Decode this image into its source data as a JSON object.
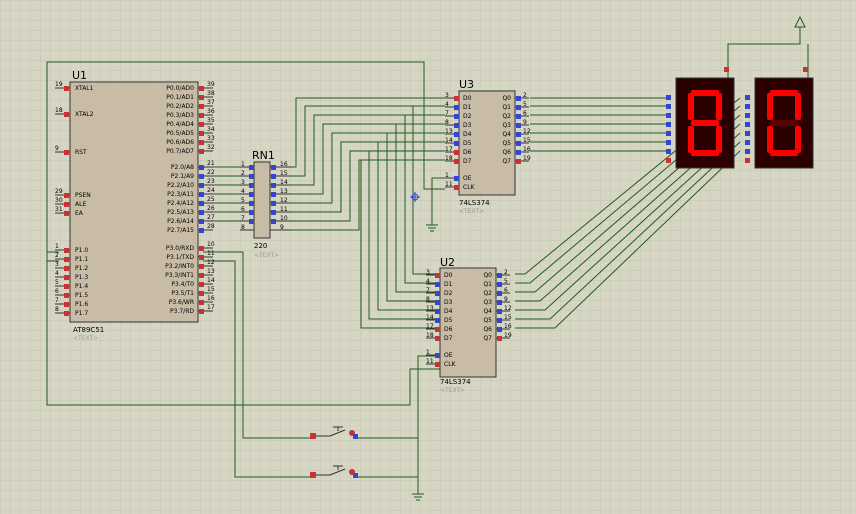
{
  "colors": {
    "background": "#d6d6c4",
    "grid": "#c4c4b0",
    "chip_fill": "#c8bca7",
    "outline": "#333333",
    "wire": "#1f5a1f",
    "pin_red": "#c83232",
    "pin_blue": "#3246d0",
    "segment_on": "#ff0000",
    "segment_off": "#5a0000",
    "display_bg": "#2a0000",
    "text_dim": "#9a9a88"
  },
  "u1": {
    "ref": "U1",
    "part": "AT89C51",
    "text_placeholder": "<TEXT>",
    "left_pins": [
      {
        "num": "19",
        "name": "XTAL1"
      },
      {
        "num": "18",
        "name": "XTAL2"
      },
      {
        "num": "9",
        "name": "RST"
      },
      {
        "num": "29",
        "name": "PSEN"
      },
      {
        "num": "30",
        "name": "ALE"
      },
      {
        "num": "31",
        "name": "EA"
      },
      {
        "num": "1",
        "name": "P1.0"
      },
      {
        "num": "2",
        "name": "P1.1"
      },
      {
        "num": "3",
        "name": "P1.2"
      },
      {
        "num": "4",
        "name": "P1.3"
      },
      {
        "num": "5",
        "name": "P1.4"
      },
      {
        "num": "6",
        "name": "P1.5"
      },
      {
        "num": "7",
        "name": "P1.6"
      },
      {
        "num": "8",
        "name": "P1.7"
      }
    ],
    "right_pins": [
      {
        "num": "39",
        "name": "P0.0/AD0"
      },
      {
        "num": "38",
        "name": "P0.1/AD1"
      },
      {
        "num": "37",
        "name": "P0.2/AD2"
      },
      {
        "num": "36",
        "name": "P0.3/AD3"
      },
      {
        "num": "35",
        "name": "P0.4/AD4"
      },
      {
        "num": "34",
        "name": "P0.5/AD5"
      },
      {
        "num": "33",
        "name": "P0.6/AD6"
      },
      {
        "num": "32",
        "name": "P0.7/AD7"
      },
      {
        "num": "21",
        "name": "P2.0/A8"
      },
      {
        "num": "22",
        "name": "P2.1/A9"
      },
      {
        "num": "23",
        "name": "P2.2/A10"
      },
      {
        "num": "24",
        "name": "P2.3/A11"
      },
      {
        "num": "25",
        "name": "P2.4/A12"
      },
      {
        "num": "26",
        "name": "P2.5/A13"
      },
      {
        "num": "27",
        "name": "P2.6/A14"
      },
      {
        "num": "28",
        "name": "P2.7/A15"
      },
      {
        "num": "10",
        "name": "P3.0/RXD"
      },
      {
        "num": "11",
        "name": "P3.1/TXD"
      },
      {
        "num": "12",
        "name": "P3.2/INT0"
      },
      {
        "num": "13",
        "name": "P3.3/INT1"
      },
      {
        "num": "14",
        "name": "P3.4/T0"
      },
      {
        "num": "15",
        "name": "P3.5/T1"
      },
      {
        "num": "16",
        "name": "P3.6/WR"
      },
      {
        "num": "17",
        "name": "P3.7/RD"
      }
    ]
  },
  "rn1": {
    "ref": "RN1",
    "value": "220",
    "text_placeholder": "<TEXT>",
    "left_pins": [
      "1",
      "2",
      "3",
      "4",
      "5",
      "6",
      "7",
      "8"
    ],
    "right_pins": [
      "16",
      "15",
      "14",
      "13",
      "12",
      "11",
      "10",
      "9"
    ]
  },
  "u3": {
    "ref": "U3",
    "part": "74LS374",
    "text_placeholder": "<TEXT>",
    "d_pins": [
      {
        "num": "3",
        "name": "D0"
      },
      {
        "num": "4",
        "name": "D1"
      },
      {
        "num": "7",
        "name": "D2"
      },
      {
        "num": "8",
        "name": "D3"
      },
      {
        "num": "13",
        "name": "D4"
      },
      {
        "num": "14",
        "name": "D5"
      },
      {
        "num": "17",
        "name": "D6"
      },
      {
        "num": "18",
        "name": "D7"
      }
    ],
    "q_pins": [
      {
        "num": "2",
        "name": "Q0"
      },
      {
        "num": "5",
        "name": "Q1"
      },
      {
        "num": "6",
        "name": "Q2"
      },
      {
        "num": "9",
        "name": "Q3"
      },
      {
        "num": "12",
        "name": "Q4"
      },
      {
        "num": "15",
        "name": "Q5"
      },
      {
        "num": "16",
        "name": "Q6"
      },
      {
        "num": "19",
        "name": "Q7"
      }
    ],
    "ctrl_pins": [
      {
        "num": "1",
        "name": "OE"
      },
      {
        "num": "11",
        "name": "CLK"
      }
    ]
  },
  "u2": {
    "ref": "U2",
    "part": "74LS374",
    "text_placeholder": "<TEXT>",
    "d_pins": [
      {
        "num": "3",
        "name": "D0"
      },
      {
        "num": "4",
        "name": "D1"
      },
      {
        "num": "7",
        "name": "D2"
      },
      {
        "num": "8",
        "name": "D3"
      },
      {
        "num": "13",
        "name": "D4"
      },
      {
        "num": "14",
        "name": "D5"
      },
      {
        "num": "17",
        "name": "D6"
      },
      {
        "num": "18",
        "name": "D7"
      }
    ],
    "q_pins": [
      {
        "num": "2",
        "name": "Q0"
      },
      {
        "num": "5",
        "name": "Q1"
      },
      {
        "num": "6",
        "name": "Q2"
      },
      {
        "num": "9",
        "name": "Q3"
      },
      {
        "num": "12",
        "name": "Q4"
      },
      {
        "num": "15",
        "name": "Q5"
      },
      {
        "num": "16",
        "name": "Q6"
      },
      {
        "num": "19",
        "name": "Q7"
      }
    ],
    "ctrl_pins": [
      {
        "num": "1",
        "name": "OE"
      },
      {
        "num": "11",
        "name": "CLK"
      }
    ]
  },
  "displays": [
    {
      "digit": "8"
    },
    {
      "digit": "0"
    }
  ],
  "buttons": [
    {
      "name": "button-1"
    },
    {
      "name": "button-2"
    }
  ]
}
